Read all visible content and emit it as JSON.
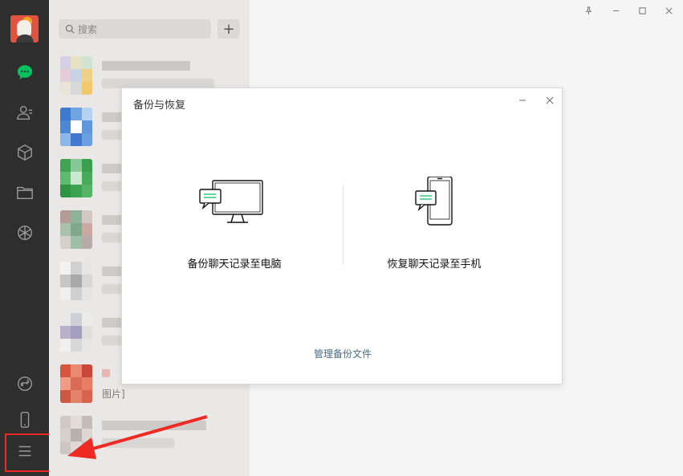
{
  "search": {
    "placeholder": "搜索"
  },
  "list": {
    "snippet_image": "图片]"
  },
  "dialog": {
    "title": "备份与恢复",
    "backup_label": "备份聊天记录至电脑",
    "restore_label": "恢复聊天记录至手机",
    "manage_link": "管理备份文件"
  },
  "nav_icons": [
    "chat-icon",
    "contacts-icon",
    "favorites-icon",
    "files-icon",
    "moments-icon",
    "miniprogram-icon",
    "phone-icon",
    "menu-icon"
  ],
  "colors": {
    "nav_bg": "#2e2e2e",
    "chat_active": "#07c160",
    "highlight": "#ee2a24",
    "link": "#4a6b8c"
  }
}
